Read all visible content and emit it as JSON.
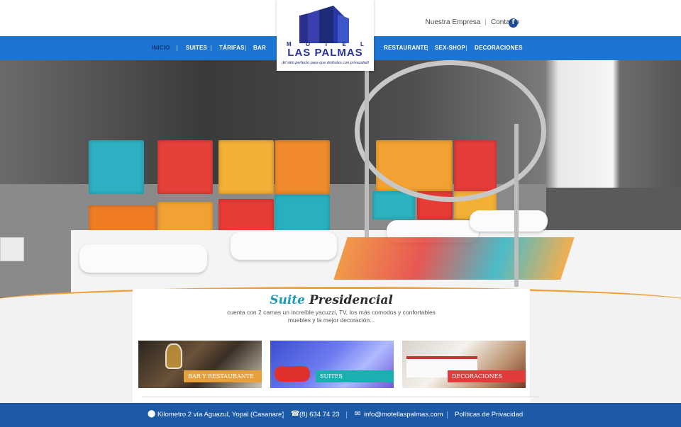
{
  "header": {
    "links": [
      "Nuestra Empresa",
      "Contacto"
    ],
    "facebook_icon": "facebook-icon",
    "facebook_glyph": "f"
  },
  "logo": {
    "motel": "M O T E L",
    "name": "LAS PALMAS",
    "tagline": "¡El sitio perfecto para que disfrutes con privacidad!",
    "colors": {
      "dark": "#1e2c78",
      "brand": "#2832a0"
    }
  },
  "nav": {
    "items": [
      "INICIO",
      "SUITES",
      "TÁRIFAS",
      "BAR",
      "RESTAURANTE",
      "SEX-SHOP",
      "DECORACIONES"
    ],
    "active": "INICIO",
    "bg_color": "#1c75d2"
  },
  "hero": {
    "title_part1": "Suite",
    "title_part2": "Presidencial",
    "description": "cuenta con 2 camas un increíble yacuzzi, TV, los más comodos y confortables muebles y la mejor decoración...",
    "accent_color": "#f0a23a"
  },
  "cards": [
    {
      "label": "BAR Y RESTAURANTE",
      "color": "#e8a13a"
    },
    {
      "label": "SUITES",
      "color": "#1bb0b0"
    },
    {
      "label": "DECORACIONES",
      "color": "#e23b3b"
    }
  ],
  "footer": {
    "address": "Kilometro 2 vía Aguazul, Yopal (Casanare)",
    "phone": "(8) 634 74 23",
    "email": "info@motellaspalmas.com",
    "privacy": "Políticas de Privacidad",
    "icons": {
      "location": "map-pin-icon",
      "phone": "phone-icon",
      "email": "envelope-icon"
    },
    "bg_color": "#1c5aa8"
  }
}
